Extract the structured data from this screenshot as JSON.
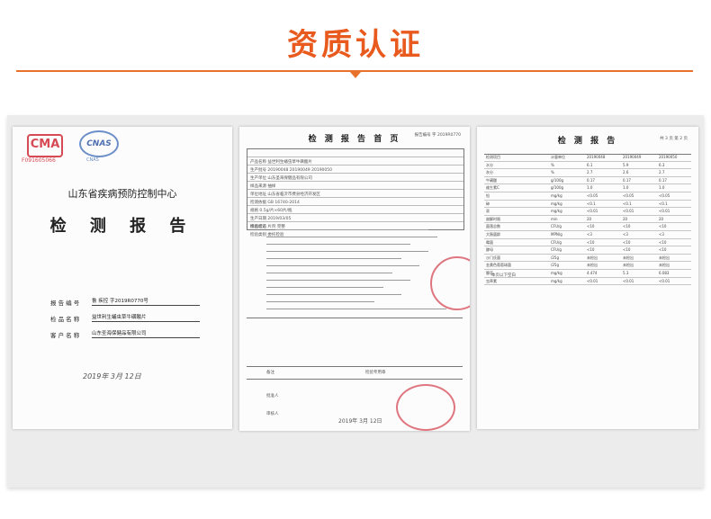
{
  "header": {
    "title": "资质认证"
  },
  "doc1": {
    "cma_logo": "CMA",
    "cnas_logo": "CNAS",
    "cma_code": "F091605066",
    "cnas_code": "CNAS",
    "org": "山东省疾病预防控制中心",
    "title": "检 测 报 告",
    "fields": [
      {
        "label": "报 告 编 号",
        "value": "鲁 疾控 字2019R0770号"
      },
      {
        "label": "检 品 名 称",
        "value": "益世利生蛹虫草牛磺酸片"
      },
      {
        "label": "客 户 名 称",
        "value": "山东圣海保健品有限公司"
      }
    ],
    "signature_date": "2019年 3月 12日"
  },
  "doc2": {
    "title": "检 测 报 告 首 页",
    "no": "报告编号 字 2019R0770",
    "grid_rows": [
      "产品名称   益世利生蛹虫草牛磺酸片",
      "生产批号   20190048  20190049  20190050",
      "生产单位   山东圣海保健品有限公司",
      "样品来源   抽样",
      "单位地址   山东省临沂市费县经济开发区",
      "检测依据   GB 16740-2014",
      "规格      0.5g/片×60片/瓶",
      "生产日期   2019/03/05",
      "样品状态   片剂  完整",
      "检验类别   委托检验"
    ],
    "conclusion_label": "检验结论",
    "footer_left": "备注",
    "footer_right": "检验专用章",
    "approver": "批准人",
    "reviewer": "审核人",
    "date": "2019年 3月 12日"
  },
  "doc3": {
    "title": "检 测 报 告",
    "page": "共 3 页 第 2 页",
    "headers": [
      "检测项目",
      "计量单位",
      "20190048",
      "20190049",
      "20190050"
    ],
    "rows": [
      [
        "水分",
        "%",
        "6.1",
        "5.9",
        "6.3"
      ],
      [
        "灰分",
        "%",
        "2.7",
        "2.6",
        "2.7"
      ],
      [
        "牛磺酸",
        "g/100g",
        "0.17",
        "0.17",
        "0.17"
      ],
      [
        "维生素C",
        "g/100g",
        "1.0",
        "1.0",
        "1.0"
      ],
      [
        "铅",
        "mg/kg",
        "<0.05",
        "<0.05",
        "<0.05"
      ],
      [
        "砷",
        "mg/kg",
        "<0.1",
        "<0.1",
        "<0.1"
      ],
      [
        "汞",
        "mg/kg",
        "<0.01",
        "<0.01",
        "<0.01"
      ],
      [
        "崩解时限",
        "min",
        "20",
        "20",
        "20"
      ],
      [
        "菌落总数",
        "CFU/g",
        "<10",
        "<10",
        "<10"
      ],
      [
        "大肠菌群",
        "MPN/g",
        "<3",
        "<3",
        "<3"
      ],
      [
        "霉菌",
        "CFU/g",
        "<10",
        "<10",
        "<10"
      ],
      [
        "酵母",
        "CFU/g",
        "<10",
        "<10",
        "<10"
      ],
      [
        "沙门氏菌",
        "/25g",
        "未检出",
        "未检出",
        "未检出"
      ],
      [
        "金黄色葡萄球菌",
        "/25g",
        "未检出",
        "未检出",
        "未检出"
      ],
      [
        "腺苷",
        "mg/kg",
        "4.474",
        "5.3",
        "6.083"
      ],
      [
        "虫草素",
        "mg/kg",
        "<0.01",
        "<0.01",
        "<0.01"
      ]
    ],
    "footer": "本页以下空白"
  }
}
